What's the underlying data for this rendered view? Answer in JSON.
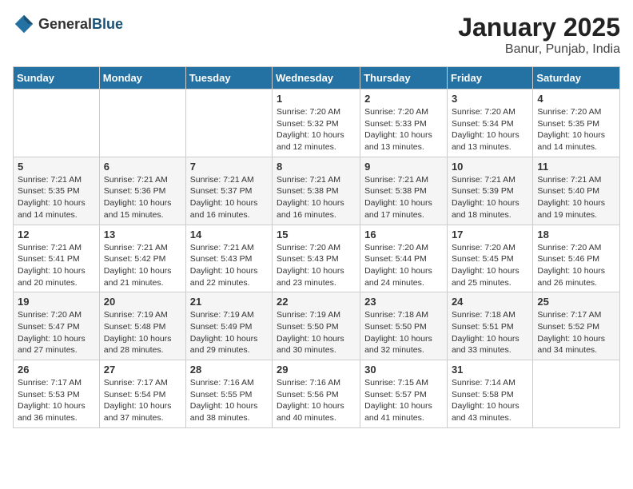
{
  "header": {
    "logo_general": "General",
    "logo_blue": "Blue",
    "month_title": "January 2025",
    "location": "Banur, Punjab, India"
  },
  "days_of_week": [
    "Sunday",
    "Monday",
    "Tuesday",
    "Wednesday",
    "Thursday",
    "Friday",
    "Saturday"
  ],
  "weeks": [
    [
      {
        "day": "",
        "info": ""
      },
      {
        "day": "",
        "info": ""
      },
      {
        "day": "",
        "info": ""
      },
      {
        "day": "1",
        "info": "Sunrise: 7:20 AM\nSunset: 5:32 PM\nDaylight: 10 hours\nand 12 minutes."
      },
      {
        "day": "2",
        "info": "Sunrise: 7:20 AM\nSunset: 5:33 PM\nDaylight: 10 hours\nand 13 minutes."
      },
      {
        "day": "3",
        "info": "Sunrise: 7:20 AM\nSunset: 5:34 PM\nDaylight: 10 hours\nand 13 minutes."
      },
      {
        "day": "4",
        "info": "Sunrise: 7:20 AM\nSunset: 5:35 PM\nDaylight: 10 hours\nand 14 minutes."
      }
    ],
    [
      {
        "day": "5",
        "info": "Sunrise: 7:21 AM\nSunset: 5:35 PM\nDaylight: 10 hours\nand 14 minutes."
      },
      {
        "day": "6",
        "info": "Sunrise: 7:21 AM\nSunset: 5:36 PM\nDaylight: 10 hours\nand 15 minutes."
      },
      {
        "day": "7",
        "info": "Sunrise: 7:21 AM\nSunset: 5:37 PM\nDaylight: 10 hours\nand 16 minutes."
      },
      {
        "day": "8",
        "info": "Sunrise: 7:21 AM\nSunset: 5:38 PM\nDaylight: 10 hours\nand 16 minutes."
      },
      {
        "day": "9",
        "info": "Sunrise: 7:21 AM\nSunset: 5:38 PM\nDaylight: 10 hours\nand 17 minutes."
      },
      {
        "day": "10",
        "info": "Sunrise: 7:21 AM\nSunset: 5:39 PM\nDaylight: 10 hours\nand 18 minutes."
      },
      {
        "day": "11",
        "info": "Sunrise: 7:21 AM\nSunset: 5:40 PM\nDaylight: 10 hours\nand 19 minutes."
      }
    ],
    [
      {
        "day": "12",
        "info": "Sunrise: 7:21 AM\nSunset: 5:41 PM\nDaylight: 10 hours\nand 20 minutes."
      },
      {
        "day": "13",
        "info": "Sunrise: 7:21 AM\nSunset: 5:42 PM\nDaylight: 10 hours\nand 21 minutes."
      },
      {
        "day": "14",
        "info": "Sunrise: 7:21 AM\nSunset: 5:43 PM\nDaylight: 10 hours\nand 22 minutes."
      },
      {
        "day": "15",
        "info": "Sunrise: 7:20 AM\nSunset: 5:43 PM\nDaylight: 10 hours\nand 23 minutes."
      },
      {
        "day": "16",
        "info": "Sunrise: 7:20 AM\nSunset: 5:44 PM\nDaylight: 10 hours\nand 24 minutes."
      },
      {
        "day": "17",
        "info": "Sunrise: 7:20 AM\nSunset: 5:45 PM\nDaylight: 10 hours\nand 25 minutes."
      },
      {
        "day": "18",
        "info": "Sunrise: 7:20 AM\nSunset: 5:46 PM\nDaylight: 10 hours\nand 26 minutes."
      }
    ],
    [
      {
        "day": "19",
        "info": "Sunrise: 7:20 AM\nSunset: 5:47 PM\nDaylight: 10 hours\nand 27 minutes."
      },
      {
        "day": "20",
        "info": "Sunrise: 7:19 AM\nSunset: 5:48 PM\nDaylight: 10 hours\nand 28 minutes."
      },
      {
        "day": "21",
        "info": "Sunrise: 7:19 AM\nSunset: 5:49 PM\nDaylight: 10 hours\nand 29 minutes."
      },
      {
        "day": "22",
        "info": "Sunrise: 7:19 AM\nSunset: 5:50 PM\nDaylight: 10 hours\nand 30 minutes."
      },
      {
        "day": "23",
        "info": "Sunrise: 7:18 AM\nSunset: 5:50 PM\nDaylight: 10 hours\nand 32 minutes."
      },
      {
        "day": "24",
        "info": "Sunrise: 7:18 AM\nSunset: 5:51 PM\nDaylight: 10 hours\nand 33 minutes."
      },
      {
        "day": "25",
        "info": "Sunrise: 7:17 AM\nSunset: 5:52 PM\nDaylight: 10 hours\nand 34 minutes."
      }
    ],
    [
      {
        "day": "26",
        "info": "Sunrise: 7:17 AM\nSunset: 5:53 PM\nDaylight: 10 hours\nand 36 minutes."
      },
      {
        "day": "27",
        "info": "Sunrise: 7:17 AM\nSunset: 5:54 PM\nDaylight: 10 hours\nand 37 minutes."
      },
      {
        "day": "28",
        "info": "Sunrise: 7:16 AM\nSunset: 5:55 PM\nDaylight: 10 hours\nand 38 minutes."
      },
      {
        "day": "29",
        "info": "Sunrise: 7:16 AM\nSunset: 5:56 PM\nDaylight: 10 hours\nand 40 minutes."
      },
      {
        "day": "30",
        "info": "Sunrise: 7:15 AM\nSunset: 5:57 PM\nDaylight: 10 hours\nand 41 minutes."
      },
      {
        "day": "31",
        "info": "Sunrise: 7:14 AM\nSunset: 5:58 PM\nDaylight: 10 hours\nand 43 minutes."
      },
      {
        "day": "",
        "info": ""
      }
    ]
  ]
}
